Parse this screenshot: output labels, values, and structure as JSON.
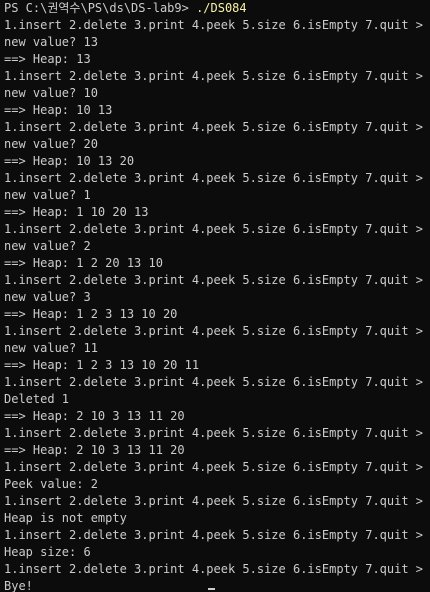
{
  "prompt": {
    "path": "PS C:\\권역수\\PS\\ds\\DS-lab9> ",
    "command": "./DS084"
  },
  "lines": [
    "1.insert 2.delete 3.print 4.peek 5.size 6.isEmpty 7.quit > 1",
    "new value? 13",
    "==> Heap: 13",
    "1.insert 2.delete 3.print 4.peek 5.size 6.isEmpty 7.quit > 1",
    "new value? 10",
    "==> Heap: 10 13",
    "1.insert 2.delete 3.print 4.peek 5.size 6.isEmpty 7.quit > 1",
    "new value? 20",
    "==> Heap: 10 13 20",
    "1.insert 2.delete 3.print 4.peek 5.size 6.isEmpty 7.quit > 1",
    "new value? 1",
    "==> Heap: 1 10 20 13",
    "1.insert 2.delete 3.print 4.peek 5.size 6.isEmpty 7.quit > 1",
    "new value? 2",
    "==> Heap: 1 2 20 13 10",
    "1.insert 2.delete 3.print 4.peek 5.size 6.isEmpty 7.quit > 1",
    "new value? 3",
    "==> Heap: 1 2 3 13 10 20",
    "1.insert 2.delete 3.print 4.peek 5.size 6.isEmpty 7.quit > 1",
    "new value? 11",
    "==> Heap: 1 2 3 13 10 20 11",
    "1.insert 2.delete 3.print 4.peek 5.size 6.isEmpty 7.quit > 2",
    "Deleted 1",
    "==> Heap: 2 10 3 13 11 20",
    "1.insert 2.delete 3.print 4.peek 5.size 6.isEmpty 7.quit > 3",
    "==> Heap: 2 10 3 13 11 20",
    "1.insert 2.delete 3.print 4.peek 5.size 6.isEmpty 7.quit > 4",
    "Peek value: 2",
    "1.insert 2.delete 3.print 4.peek 5.size 6.isEmpty 7.quit > 6",
    "Heap is not empty",
    "1.insert 2.delete 3.print 4.peek 5.size 6.isEmpty 7.quit > 5",
    "Heap size: 6",
    "1.insert 2.delete 3.print 4.peek 5.size 6.isEmpty 7.quit > 7",
    "Bye!"
  ],
  "colors": {
    "background": "#0c0c0c",
    "text": "#cccccc",
    "command": "#f9f1a5"
  }
}
